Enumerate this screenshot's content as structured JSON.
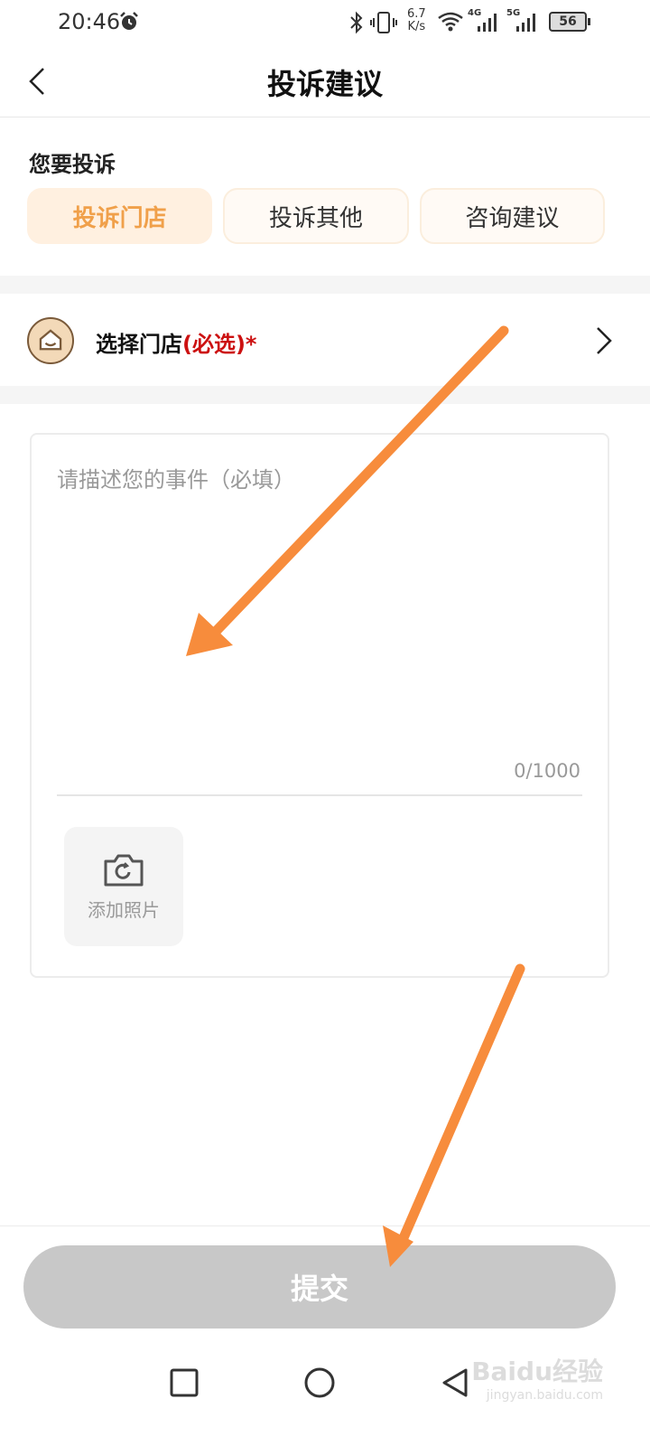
{
  "status_bar": {
    "time": "20:46",
    "net_speed_value": "6.7",
    "net_speed_unit": "K/s",
    "network_4g": "4G",
    "network_5g": "5G",
    "battery": "56"
  },
  "header": {
    "title": "投诉建议"
  },
  "complaint_type": {
    "label": "您要投诉",
    "tabs": [
      {
        "label": "投诉门店",
        "active": true
      },
      {
        "label": "投诉其他",
        "active": false
      },
      {
        "label": "咨询建议",
        "active": false
      }
    ]
  },
  "store_select": {
    "label": "选择门店",
    "required_text": "(必选)*"
  },
  "description": {
    "placeholder": "请描述您的事件（必填）",
    "value": "",
    "char_count": "0/1000",
    "add_photo_label": "添加照片"
  },
  "submit": {
    "label": "提交"
  },
  "watermark": {
    "brand": "Baidu经验",
    "url": "jingyan.baidu.com"
  },
  "colors": {
    "accent": "#f0a04a",
    "active_tab_bg": "#fff0e0",
    "required": "#cc1111",
    "submit_disabled": "#c8c8c8",
    "annotation_arrow": "#f78c3c"
  },
  "icons": {
    "alarm": "alarm-icon",
    "back": "chevron-left-icon",
    "store": "store-icon",
    "forward": "chevron-right-icon",
    "camera": "camera-icon"
  }
}
